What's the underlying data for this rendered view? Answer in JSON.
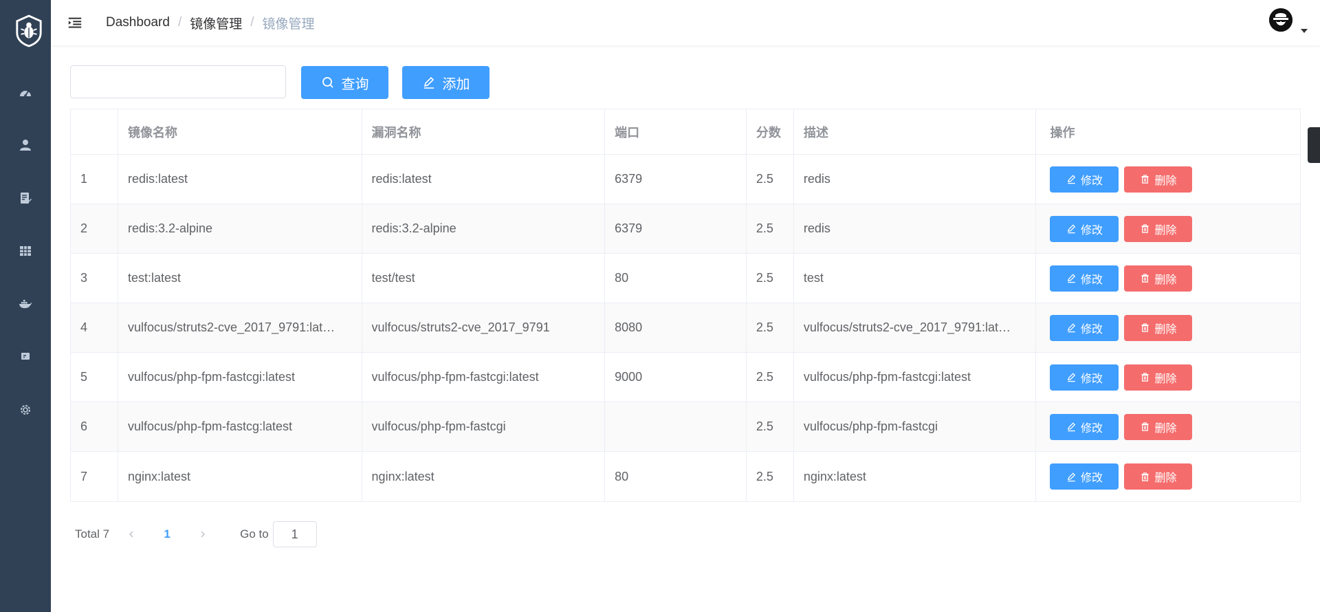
{
  "breadcrumb": [
    "Dashboard",
    "镜像管理",
    "镜像管理"
  ],
  "breadcrumb_separator": "/",
  "sidebar": {
    "items": [
      {
        "icon": "dashboard-icon"
      },
      {
        "icon": "user-icon"
      },
      {
        "icon": "document-edit-icon"
      },
      {
        "icon": "grid-icon"
      },
      {
        "icon": "docker-icon"
      },
      {
        "icon": "card-icon"
      },
      {
        "icon": "gear-icon"
      }
    ]
  },
  "toolbar": {
    "search_value": "",
    "search_placeholder": "",
    "query_label": "查询",
    "add_label": "添加"
  },
  "table": {
    "columns": [
      "",
      "镜像名称",
      "漏洞名称",
      "端口",
      "分数",
      "描述",
      "操作"
    ],
    "rows": [
      {
        "idx": "1",
        "image": "redis:latest",
        "vuln": "redis:latest",
        "port": "6379",
        "score": "2.5",
        "desc": "redis"
      },
      {
        "idx": "2",
        "image": "redis:3.2-alpine",
        "vuln": "redis:3.2-alpine",
        "port": "6379",
        "score": "2.5",
        "desc": "redis"
      },
      {
        "idx": "3",
        "image": "test:latest",
        "vuln": "test/test",
        "port": "80",
        "score": "2.5",
        "desc": "test"
      },
      {
        "idx": "4",
        "image": "vulfocus/struts2-cve_2017_9791:lat…",
        "vuln": "vulfocus/struts2-cve_2017_9791",
        "port": "8080",
        "score": "2.5",
        "desc": "vulfocus/struts2-cve_2017_9791:lat…"
      },
      {
        "idx": "5",
        "image": "vulfocus/php-fpm-fastcgi:latest",
        "vuln": "vulfocus/php-fpm-fastcgi:latest",
        "port": "9000",
        "score": "2.5",
        "desc": "vulfocus/php-fpm-fastcgi:latest"
      },
      {
        "idx": "6",
        "image": "vulfocus/php-fpm-fastcg:latest",
        "vuln": "vulfocus/php-fpm-fastcgi",
        "port": "",
        "score": "2.5",
        "desc": "vulfocus/php-fpm-fastcgi"
      },
      {
        "idx": "7",
        "image": "nginx:latest",
        "vuln": "nginx:latest",
        "port": "80",
        "score": "2.5",
        "desc": "nginx:latest"
      }
    ],
    "edit_label": "修改",
    "delete_label": "删除"
  },
  "pagination": {
    "total_label": "Total 7",
    "current_page": "1",
    "goto_label": "Go to",
    "goto_value": "1"
  },
  "colors": {
    "sidebar": "#304156",
    "primary": "#409eff",
    "danger": "#f56c6c"
  }
}
